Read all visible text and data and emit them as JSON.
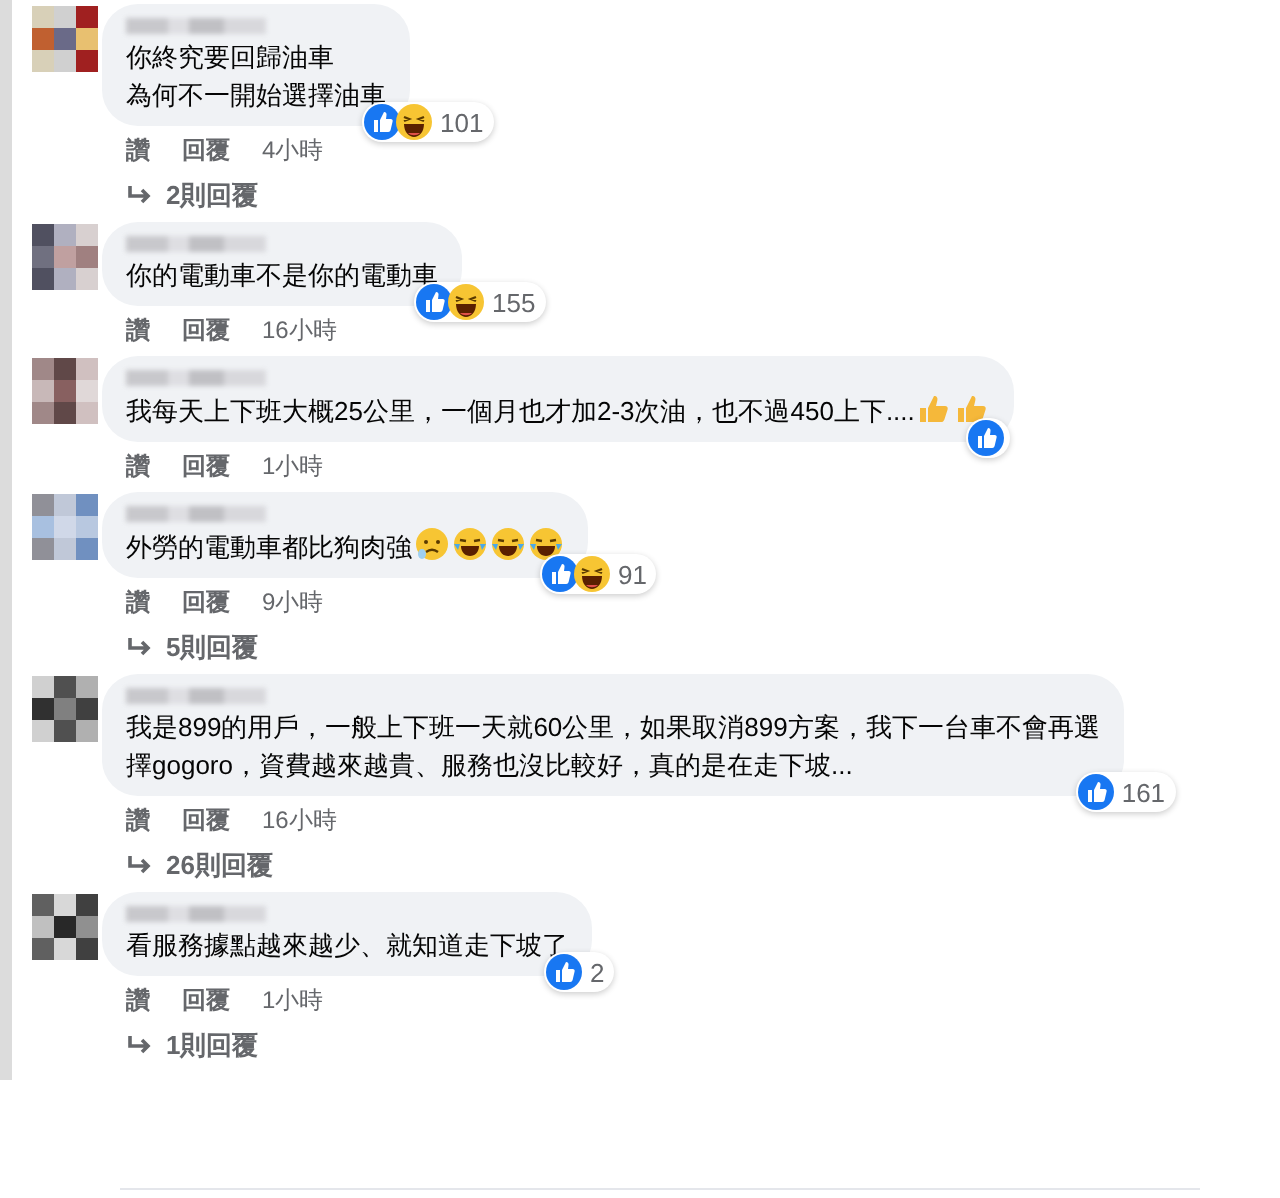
{
  "comments": [
    {
      "lines": [
        "你終究要回歸油車",
        "為何不一開始選擇油車"
      ],
      "reactions": {
        "icons": [
          {
            "kind": "like"
          },
          {
            "kind": "haha"
          }
        ],
        "count": "101"
      },
      "actions": [
        "讚",
        "回覆"
      ],
      "time": "4小時",
      "replies": "2則回覆"
    },
    {
      "lines": [
        "你的電動車不是你的電動車"
      ],
      "reactions": {
        "icons": [
          {
            "kind": "like"
          },
          {
            "kind": "haha"
          }
        ],
        "count": "155"
      },
      "actions": [
        "讚",
        "回覆"
      ],
      "time": "16小時"
    },
    {
      "lines": [
        "我每天上下班大概25公里，一個月也才加2-3次油，也不過450上下...."
      ],
      "end_icons": [
        {
          "kind": "thumb"
        },
        {
          "kind": "thumb"
        }
      ],
      "reactions": {
        "icons": [
          {
            "kind": "like"
          }
        ]
      },
      "actions": [
        "讚",
        "回覆"
      ],
      "time": "1小時"
    },
    {
      "lines": [
        "外勞的電動車都比狗肉強"
      ],
      "end_icons": [
        {
          "kind": "worried"
        },
        {
          "kind": "rofl"
        },
        {
          "kind": "rofl"
        },
        {
          "kind": "rofl"
        }
      ],
      "reactions": {
        "icons": [
          {
            "kind": "like"
          },
          {
            "kind": "haha"
          }
        ],
        "count": "91"
      },
      "actions": [
        "讚",
        "回覆"
      ],
      "time": "9小時",
      "replies": "5則回覆"
    },
    {
      "lines": [
        "我是899的用戶，一般上下班一天就60公里，如果取消899方案，我下一台車不會再選",
        "擇gogoro，資費越來越貴、服務也沒比較好，真的是在走下坡..."
      ],
      "reactions": {
        "icons": [
          {
            "kind": "like"
          }
        ],
        "count": "161"
      },
      "actions": [
        "讚",
        "回覆"
      ],
      "time": "16小時",
      "replies": "26則回覆"
    },
    {
      "lines": [
        "看服務據點越來越少、就知道走下坡了"
      ],
      "reactions": {
        "icons": [
          {
            "kind": "like"
          }
        ],
        "count": "2"
      },
      "actions": [
        "讚",
        "回覆"
      ],
      "time": "1小時",
      "replies": "1則回覆"
    }
  ]
}
